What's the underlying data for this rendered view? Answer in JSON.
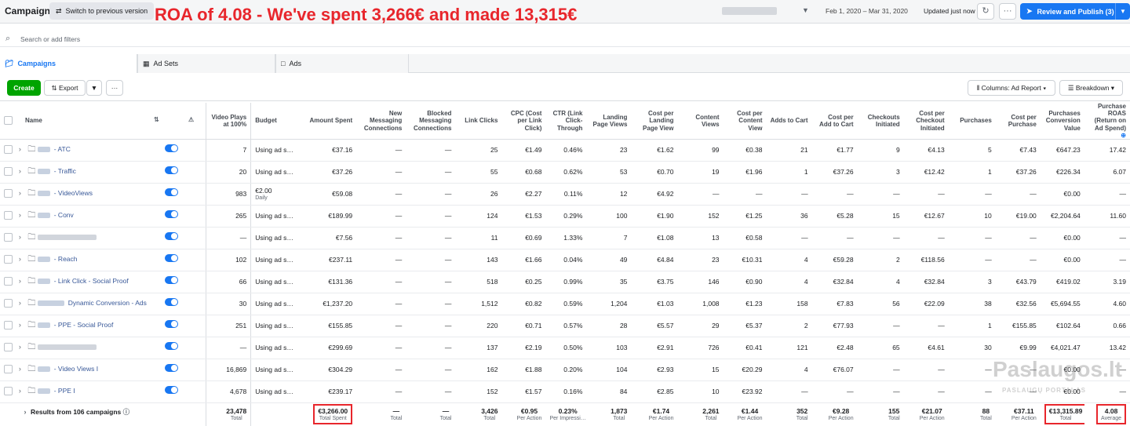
{
  "header": {
    "title": "Campaigns",
    "switch_label": "Switch to previous version",
    "annotation": "ROA of 4.08 - We've spent 3,266€ and made 13,315€",
    "date_range": "Feb 1, 2020 – Mar 31, 2020",
    "updated": "Updated just now",
    "more": "···",
    "publish_label": "Review and Publish (3)"
  },
  "search": {
    "placeholder": "Search or add filters"
  },
  "tabs": [
    {
      "label": "Campaigns"
    },
    {
      "label": "Ad Sets"
    },
    {
      "label": "Ads"
    }
  ],
  "toolbar": {
    "create": "Create",
    "export": "Export",
    "more": "···",
    "columns": "Columns: Ad Report",
    "breakdown": "Breakdown"
  },
  "columns": [
    "Name",
    "Video Plays at 100%",
    "Budget",
    "Amount Spent",
    "New Messaging Connections",
    "Blocked Messaging Connections",
    "Link Clicks",
    "CPC (Cost per Link Click)",
    "CTR (Link Click-Through",
    "Landing Page Views",
    "Cost per Landing Page View",
    "Content Views",
    "Cost per Content View",
    "Adds to Cart",
    "Cost per Add to Cart",
    "Checkouts Initiated",
    "Cost per Checkout Initiated",
    "Purchases",
    "Cost per Purchase",
    "Purchases Conversion Value",
    "Purchase ROAS (Return on Ad Spend)"
  ],
  "rows": [
    {
      "name": " - ATC",
      "blur": "short",
      "cells": [
        "7",
        "Using ad s…",
        "€37.16",
        "—",
        "—",
        "25",
        "€1.49",
        "0.46%",
        "23",
        "€1.62",
        "99",
        "€0.38",
        "21",
        "€1.77",
        "9",
        "€4.13",
        "5",
        "€7.43",
        "€647.23",
        "17.42"
      ]
    },
    {
      "name": " - Traffic",
      "blur": "short",
      "cells": [
        "20",
        "Using ad s…",
        "€37.26",
        "—",
        "—",
        "55",
        "€0.68",
        "0.62%",
        "53",
        "€0.70",
        "19",
        "€1.96",
        "1",
        "€37.26",
        "3",
        "€12.42",
        "1",
        "€37.26",
        "€226.34",
        "6.07"
      ]
    },
    {
      "name": " - VideoViews",
      "blur": "short",
      "budget_sub": "Daily",
      "cells": [
        "983",
        "€2.00",
        "€59.08",
        "—",
        "—",
        "26",
        "€2.27",
        "0.11%",
        "12",
        "€4.92",
        "—",
        "—",
        "—",
        "—",
        "—",
        "—",
        "—",
        "—",
        "€0.00",
        "—"
      ]
    },
    {
      "name": " - Conv",
      "blur": "short",
      "cells": [
        "265",
        "Using ad s…",
        "€189.99",
        "—",
        "—",
        "124",
        "€1.53",
        "0.29%",
        "100",
        "€1.90",
        "152",
        "€1.25",
        "36",
        "€5.28",
        "15",
        "€12.67",
        "10",
        "€19.00",
        "€2,204.64",
        "11.60"
      ]
    },
    {
      "name": "",
      "blur": "long",
      "cells": [
        "—",
        "Using ad s…",
        "€7.56",
        "—",
        "—",
        "11",
        "€0.69",
        "1.33%",
        "7",
        "€1.08",
        "13",
        "€0.58",
        "—",
        "—",
        "—",
        "—",
        "—",
        "—",
        "€0.00",
        "—"
      ]
    },
    {
      "name": " - Reach",
      "blur": "short",
      "cells": [
        "102",
        "Using ad s…",
        "€237.11",
        "—",
        "—",
        "143",
        "€1.66",
        "0.04%",
        "49",
        "€4.84",
        "23",
        "€10.31",
        "4",
        "€59.28",
        "2",
        "€118.56",
        "—",
        "—",
        "€0.00",
        "—"
      ]
    },
    {
      "name": " - Link Click - Social Proof",
      "blur": "short",
      "cells": [
        "66",
        "Using ad s…",
        "€131.36",
        "—",
        "—",
        "518",
        "€0.25",
        "0.99%",
        "35",
        "€3.75",
        "146",
        "€0.90",
        "4",
        "€32.84",
        "4",
        "€32.84",
        "3",
        "€43.79",
        "€419.02",
        "3.19"
      ]
    },
    {
      "name": " Dynamic Conversion - Ads",
      "blur": "mid",
      "cells": [
        "30",
        "Using ad s…",
        "€1,237.20",
        "—",
        "—",
        "1,512",
        "€0.82",
        "0.59%",
        "1,204",
        "€1.03",
        "1,008",
        "€1.23",
        "158",
        "€7.83",
        "56",
        "€22.09",
        "38",
        "€32.56",
        "€5,694.55",
        "4.60"
      ]
    },
    {
      "name": " - PPE - Social Proof",
      "blur": "short",
      "cells": [
        "251",
        "Using ad s…",
        "€155.85",
        "—",
        "—",
        "220",
        "€0.71",
        "0.57%",
        "28",
        "€5.57",
        "29",
        "€5.37",
        "2",
        "€77.93",
        "—",
        "—",
        "1",
        "€155.85",
        "€102.64",
        "0.66"
      ]
    },
    {
      "name": "",
      "blur": "long",
      "cells": [
        "—",
        "Using ad s…",
        "€299.69",
        "—",
        "—",
        "137",
        "€2.19",
        "0.50%",
        "103",
        "€2.91",
        "726",
        "€0.41",
        "121",
        "€2.48",
        "65",
        "€4.61",
        "30",
        "€9.99",
        "€4,021.47",
        "13.42"
      ]
    },
    {
      "name": " - Video Views I",
      "blur": "short",
      "cells": [
        "16,869",
        "Using ad s…",
        "€304.29",
        "—",
        "—",
        "162",
        "€1.88",
        "0.20%",
        "104",
        "€2.93",
        "15",
        "€20.29",
        "4",
        "€76.07",
        "—",
        "—",
        "—",
        "—",
        "€0.00",
        "—"
      ]
    },
    {
      "name": " - PPE I",
      "blur": "short",
      "cells": [
        "4,678",
        "Using ad s…",
        "€239.17",
        "—",
        "—",
        "152",
        "€1.57",
        "0.16%",
        "84",
        "€2.85",
        "10",
        "€23.92",
        "—",
        "—",
        "—",
        "—",
        "—",
        "—",
        "€0.00",
        "—"
      ]
    }
  ],
  "totals": {
    "label": "Results from 106 campaigns",
    "cells": [
      {
        "v": "23,478",
        "s": "Total"
      },
      {
        "v": "",
        "s": ""
      },
      {
        "v": "€3,266.00",
        "s": "Total Spent",
        "hl": true
      },
      {
        "v": "—",
        "s": "Total"
      },
      {
        "v": "—",
        "s": "Total"
      },
      {
        "v": "3,426",
        "s": "Total"
      },
      {
        "v": "€0.95",
        "s": "Per Action"
      },
      {
        "v": "0.23%",
        "s": "Per Impressi…"
      },
      {
        "v": "1,873",
        "s": "Total"
      },
      {
        "v": "€1.74",
        "s": "Per Action"
      },
      {
        "v": "2,261",
        "s": "Total"
      },
      {
        "v": "€1.44",
        "s": "Per Action"
      },
      {
        "v": "352",
        "s": "Total"
      },
      {
        "v": "€9.28",
        "s": "Per Action"
      },
      {
        "v": "155",
        "s": "Total"
      },
      {
        "v": "€21.07",
        "s": "Per Action"
      },
      {
        "v": "88",
        "s": "Total"
      },
      {
        "v": "€37.11",
        "s": "Per Action"
      },
      {
        "v": "€13,315.89",
        "s": "Total",
        "hl": true
      },
      {
        "v": "4.08",
        "s": "Average",
        "hl": true
      }
    ]
  },
  "watermark": {
    "line1": "Paslaugos.lt",
    "line2": "PASLAUGŲ PORTALAS"
  },
  "colors": {
    "accent": "#1877f2",
    "create": "#00a400",
    "annotation": "#e8262c"
  }
}
